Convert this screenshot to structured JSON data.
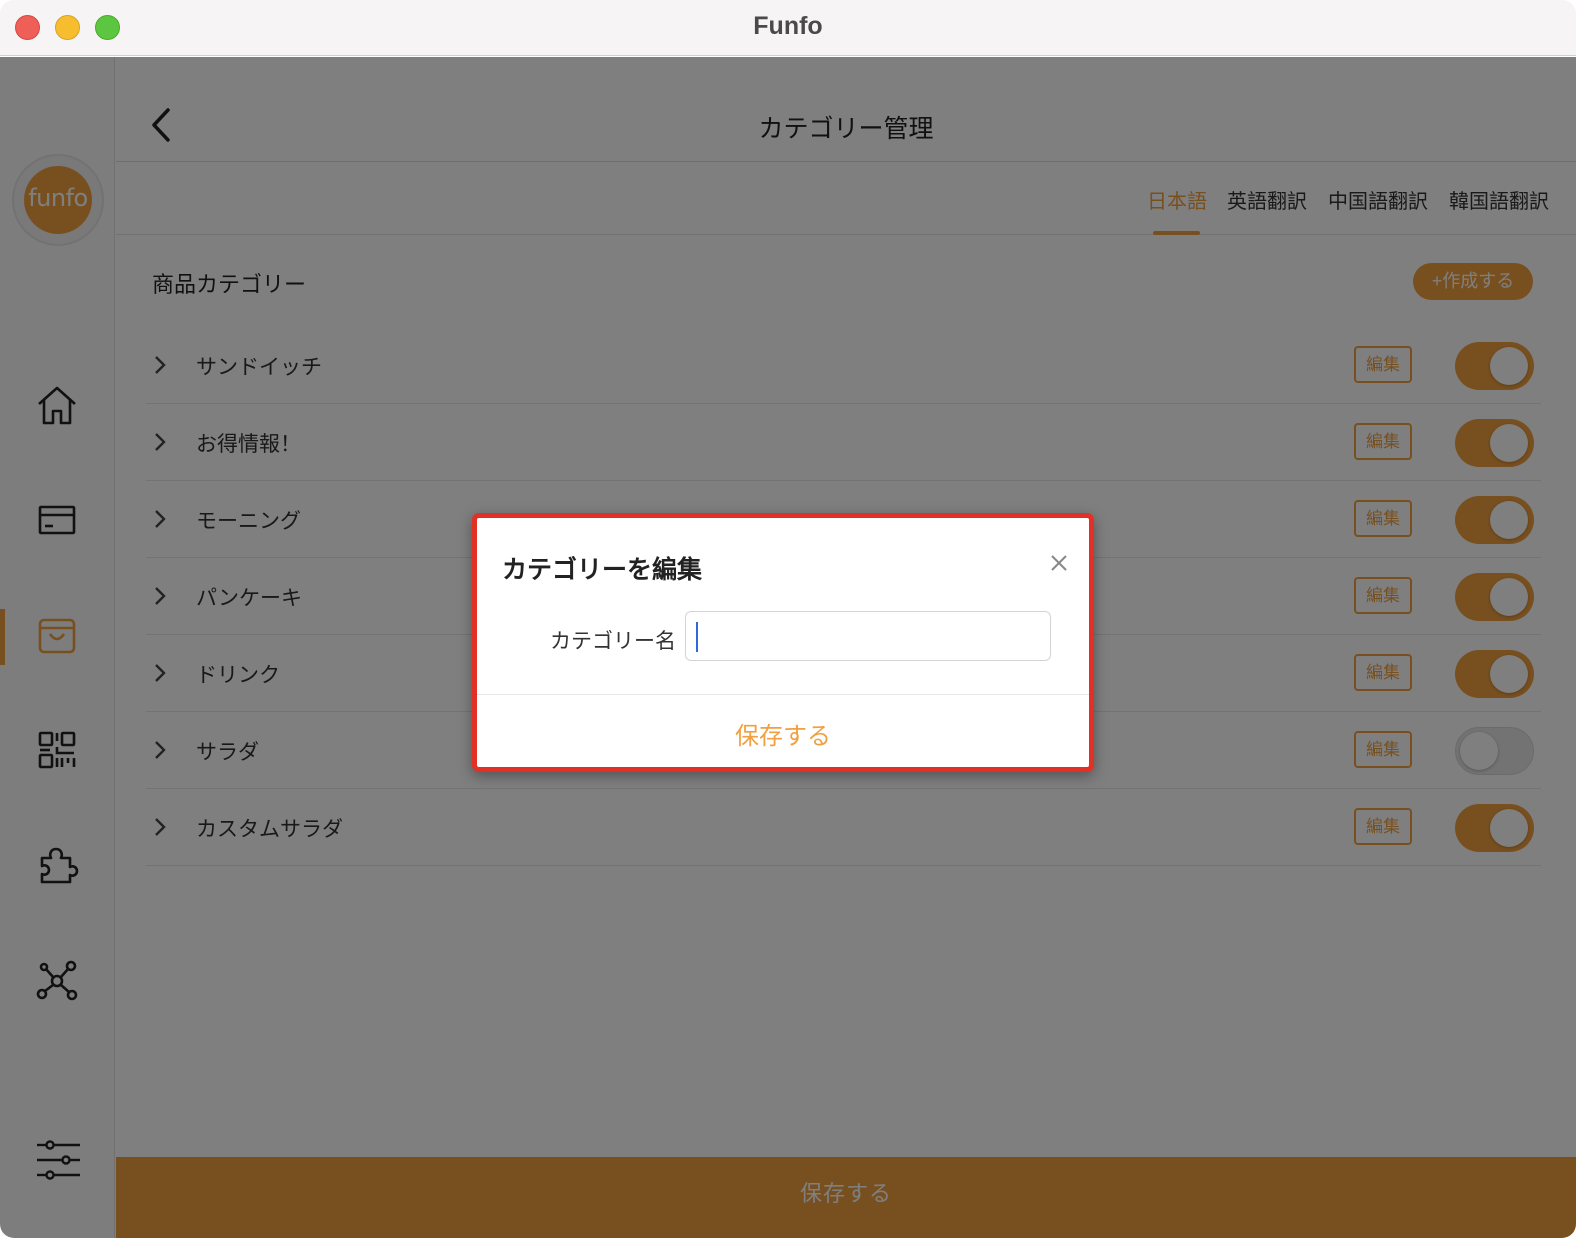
{
  "window": {
    "title": "Funfo"
  },
  "sidebar": {
    "logo_text": "funfo",
    "items": [
      {
        "name": "home",
        "icon": "home-icon"
      },
      {
        "name": "payment",
        "icon": "card-icon"
      },
      {
        "name": "products",
        "icon": "bag-icon",
        "active": true
      },
      {
        "name": "qr-code",
        "icon": "qr-code-icon"
      },
      {
        "name": "plugins",
        "icon": "puzzle-icon"
      },
      {
        "name": "network",
        "icon": "network-icon"
      },
      {
        "name": "settings",
        "icon": "sliders-icon"
      }
    ]
  },
  "header": {
    "title": "カテゴリー管理"
  },
  "tabs": [
    {
      "label": "日本語",
      "active": true
    },
    {
      "label": "英語翻訳",
      "active": false
    },
    {
      "label": "中国語翻訳",
      "active": false
    },
    {
      "label": "韓国語翻訳",
      "active": false
    }
  ],
  "section": {
    "title": "商品カテゴリー",
    "create_label": "+作成する",
    "edit_label": "編集"
  },
  "categories": [
    {
      "name": "サンドイッチ",
      "enabled": true
    },
    {
      "name": "お得情報！",
      "enabled": true
    },
    {
      "name": "モーニング",
      "enabled": true
    },
    {
      "name": "パンケーキ",
      "enabled": true
    },
    {
      "name": "ドリンク",
      "enabled": true
    },
    {
      "name": "サラダ",
      "enabled": false
    },
    {
      "name": "カスタムサラダ",
      "enabled": true
    }
  ],
  "footer": {
    "save_label": "保存する"
  },
  "modal": {
    "title": "カテゴリーを編集",
    "field_label": "カテゴリー名",
    "field_value": "",
    "save_label": "保存する"
  },
  "colors": {
    "accent": "#f0a040",
    "highlight_border": "#e23026",
    "caret": "#2f6ad9"
  }
}
